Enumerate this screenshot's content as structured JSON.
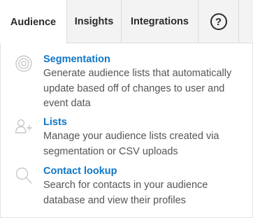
{
  "tabs": {
    "audience": "Audience",
    "insights": "Insights",
    "integrations": "Integrations",
    "help_icon": "question-circle-icon",
    "help_glyph": "?"
  },
  "items": {
    "segmentation": {
      "title": "Segmentation",
      "description": "Generate audience lists that automatically update based off of changes to user and event data",
      "icon": "target-icon"
    },
    "lists": {
      "title": "Lists",
      "description": "Manage your audience lists created via segmentation or CSV uploads",
      "icon": "add-user-icon"
    },
    "contact_lookup": {
      "title": "Contact lookup",
      "description": "Search for contacts in your audience database and view their profiles",
      "icon": "search-icon"
    }
  },
  "colors": {
    "link": "#1177c8",
    "tab_bar": "#f3f3f3",
    "icon": "#c8c8c8"
  }
}
